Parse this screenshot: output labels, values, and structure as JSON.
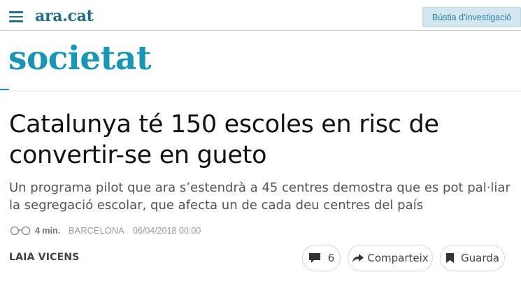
{
  "header": {
    "logo": "ara.cat",
    "bustia_label": "Bústia d’investigació"
  },
  "section": {
    "title": "societat"
  },
  "article": {
    "headline": "Catalunya té 150 escoles en risc de convertir-se en gueto",
    "subheadline": "Un programa pilot que ara s’estendrà a 45 centres demostra que es pot pal·liar la segregació escolar, que afecta un de cada deu centres del país",
    "read_time": "4 min.",
    "location": "BARCELONA",
    "datetime": "06/04/2018 00:00",
    "author": "LAIA VICENS"
  },
  "actions": {
    "comments_count": "6",
    "share_label": "Comparteix",
    "save_label": "Guarda"
  },
  "icons": {
    "menu": "hamburger-icon",
    "reading": "glasses-icon",
    "comments": "comment-bubble-icon",
    "share": "share-arrow-icon",
    "save": "bookmark-icon"
  },
  "colors": {
    "brand": "#1f6e8c",
    "section": "#1797b5",
    "button_bg": "#d4e7f0"
  }
}
